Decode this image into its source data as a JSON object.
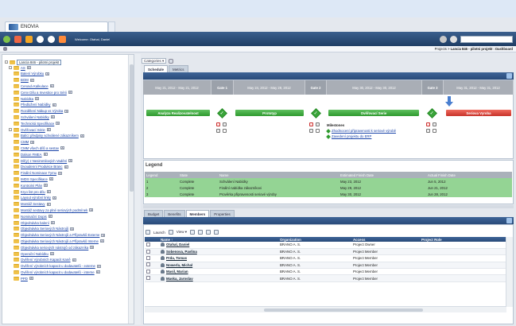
{
  "tab": {
    "title": "ENOVIA"
  },
  "toolbar": {
    "welcome": "Welcome: Otahal, Daniel",
    "search_placeholder": ""
  },
  "breadcrumb": {
    "prefix": "Projects > ",
    "current": "Lancia 846 - pilotni projekt : Dashboard"
  },
  "tree": {
    "root": "Lancia 846 - pilotni projekt",
    "items": [
      {
        "label": "AS",
        "level": 1,
        "expand": true
      },
      {
        "label": "Balení Výrobku",
        "level": 2
      },
      {
        "label": "BOM",
        "level": 2
      },
      {
        "label": "Cenová Kalkulace",
        "level": 2
      },
      {
        "label": "Cenv Dílu a Investice pro Sérii",
        "level": 2
      },
      {
        "label": "Nabídka",
        "level": 2
      },
      {
        "label": "Předložení Nabídky",
        "level": 2
      },
      {
        "label": "Rozdělení Nákup vs Výroba",
        "level": 2
      },
      {
        "label": "Schválení Nabídky",
        "level": 2
      },
      {
        "label": "Technická Specifikace",
        "level": 2
      },
      {
        "label": "Ověřovací Série",
        "level": 1,
        "expand": true
      },
      {
        "label": "Balící předpisy schválené zákazníkem",
        "level": 2
      },
      {
        "label": "CMM",
        "level": 2
      },
      {
        "label": "CMM všech dílů a sestav",
        "level": 2
      },
      {
        "label": "Dalson FMEA",
        "level": 2
      },
      {
        "label": "Díl(y) z Nesimmilových Vadění",
        "level": 2
      },
      {
        "label": "Dvoudenní Produkce Branc",
        "level": 2
      },
      {
        "label": "Finální Nominace Tymu",
        "level": 2
      },
      {
        "label": "IMDS Specifikace",
        "level": 2
      },
      {
        "label": "Kontrolní Plán",
        "level": 2
      },
      {
        "label": "Kryo list pro dílu",
        "level": 2
      },
      {
        "label": "Layout výrobní linky",
        "level": 2
      },
      {
        "label": "Montáž Sestavy",
        "level": 2
      },
      {
        "label": "Montáž sestavy za plné seriových podmínek",
        "level": 2
      },
      {
        "label": "Nominační Dopis",
        "level": 2
      },
      {
        "label": "Objednávka balení",
        "level": 2
      },
      {
        "label": "Objednávka Seriových Nástrojů",
        "level": 2
      },
      {
        "label": "Objednávka Seriových Nástrojů a Přípravků Externe",
        "level": 2
      },
      {
        "label": "Objednávka Seriových Nástrojů a Přípravků Interne",
        "level": 2
      },
      {
        "label": "Objednávka seriových nástrojů od zákazníka",
        "level": 2
      },
      {
        "label": "Operační Nabídku",
        "level": 2
      },
      {
        "label": "Ověření Výrobních Kapacit Kaně",
        "level": 2
      },
      {
        "label": "Ověření výrobních kapacit u dodavatelů - externe",
        "level": 2
      },
      {
        "label": "Ověření výrobních kapacit u dodavatelů - interne",
        "level": 2
      },
      {
        "label": "PPD",
        "level": 2
      }
    ]
  },
  "view": {
    "categories_label": "Categories ▾"
  },
  "tabs_top": [
    "Schedule",
    "Metrics"
  ],
  "phases": [
    {
      "label": "May 21, 2012 - May 21, 2012",
      "gate": false
    },
    {
      "label": "Gate 1",
      "gate": true
    },
    {
      "label": "May 24, 2012 - May 29, 2012",
      "gate": false
    },
    {
      "label": "Gate 2",
      "gate": true
    },
    {
      "label": "May 30, 2012 - May 30, 2012",
      "gate": false
    },
    {
      "label": "Gate 3",
      "gate": true
    },
    {
      "label": "May 31, 2012 - May 31, 2012",
      "gate": false
    }
  ],
  "bars": [
    {
      "label": "Analyza Realizovatelnost",
      "color": "green"
    },
    {
      "label": "Prototyp",
      "color": "green"
    },
    {
      "label": "Ověřovací Serie",
      "color": "green"
    },
    {
      "label": "Seriova Vyroba",
      "color": "red"
    }
  ],
  "milestones": {
    "title": "Milestones",
    "items": [
      "Zhodnocení připravenosti k seriové výrobě",
      "Zavedení projektu do ERP"
    ]
  },
  "legend": {
    "title": "Legend",
    "columns": [
      "Legend",
      "State",
      "Name",
      "Estimated Finish Date",
      "Actual Finish Date"
    ],
    "rows": [
      [
        "1",
        "Complete",
        "Schválení Nabídky",
        "May 23, 2012",
        "Jun 5, 2012"
      ],
      [
        "2",
        "Complete",
        "Finální nabídka zákazníkovi",
        "May 29, 2012",
        "Jun 21, 2012"
      ],
      [
        "3",
        "Complete",
        "Prověrka připravenosti seriové výroby",
        "May 30, 2012",
        "Jun 28, 2012"
      ]
    ]
  },
  "tabs_bottom": [
    "Budget",
    "Benefits",
    "Members",
    "Properties"
  ],
  "members_toolbar": {
    "launch": "Launch",
    "view": "View ▾"
  },
  "members": {
    "columns": [
      "",
      "Name ↑",
      "Organization",
      "Access",
      "Project Role"
    ],
    "rows": [
      [
        "Otahal, Daniel",
        "BRANO A. S.",
        "Project Owner",
        ""
      ],
      [
        "Sobenova, Pavlina",
        "BRANO A. S.",
        "Project Member",
        ""
      ],
      [
        "Prda, Tomas",
        "BRANO A. S.",
        "Project Member",
        ""
      ],
      [
        "Nowerla, Michal",
        "BRANO A. S.",
        "Project Member",
        ""
      ],
      [
        "Masil, Marian",
        "BRANO A. S.",
        "Project Member",
        ""
      ],
      [
        "Maska, Jaroslav",
        "BRANO A. S.",
        "Project Member",
        ""
      ]
    ]
  },
  "colors": {
    "header_blue": "#294b7a",
    "bar_green": "#2e9a2e",
    "bar_red": "#c8332a",
    "legend_green": "#94d494"
  }
}
